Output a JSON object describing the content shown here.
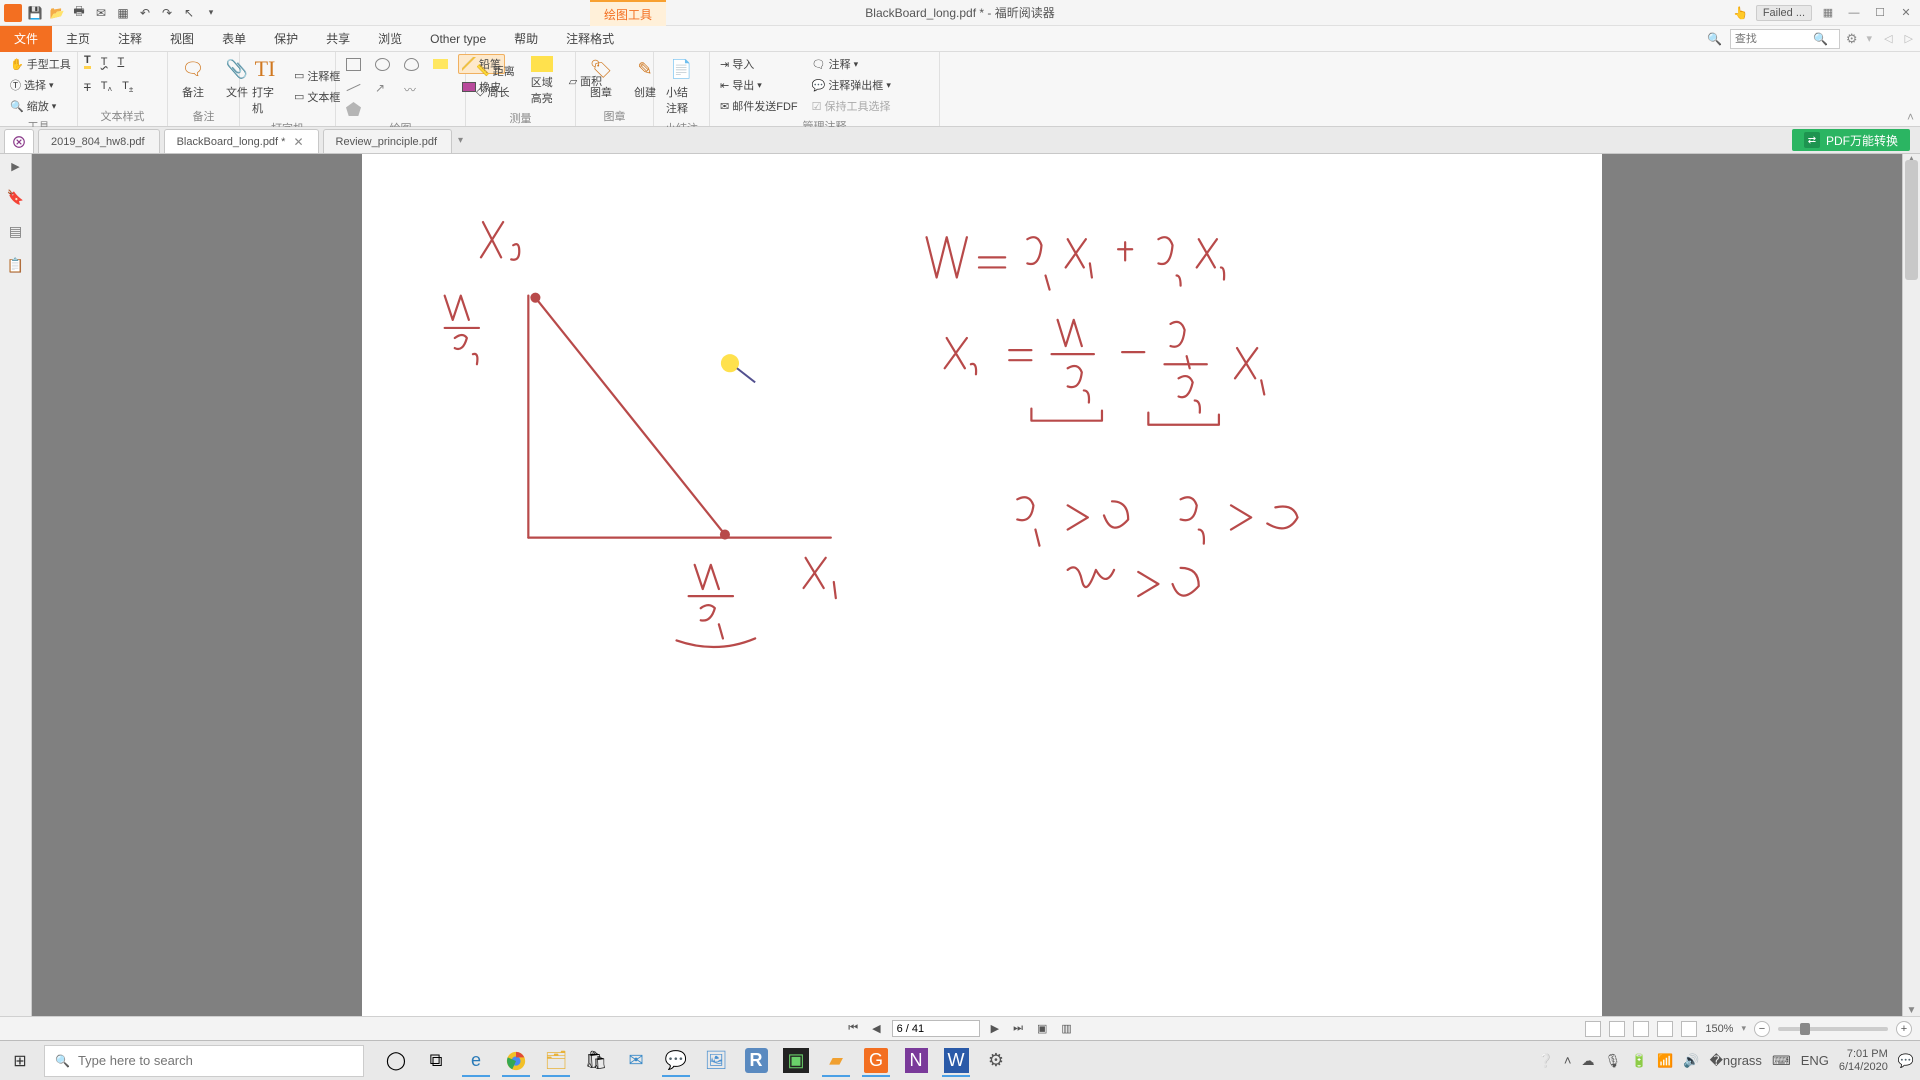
{
  "titlebar": {
    "doc_title": "BlackBoard_long.pdf * - 福昕阅读器",
    "drawing_tools": "绘图工具",
    "failed": "Failed ...",
    "qat": [
      "save-icon",
      "open-icon",
      "print-icon",
      "mail-icon",
      "new-icon",
      "undo-icon",
      "redo-icon",
      "pointer-icon"
    ]
  },
  "menu": {
    "items": [
      "文件",
      "主页",
      "注释",
      "视图",
      "表单",
      "保护",
      "共享",
      "浏览",
      "Other type",
      "帮助",
      "注释格式"
    ],
    "active_index": 0,
    "search_placeholder": "查找"
  },
  "ribbon": {
    "g_tools": {
      "label": "工具",
      "hand": "手型工具",
      "select": "选择",
      "zoom": "缩放"
    },
    "g_text": {
      "label": "文本样式"
    },
    "g_note": {
      "label": "备注",
      "note": "备注",
      "file": "文件"
    },
    "g_type": {
      "label": "打字机",
      "type": "打字机",
      "textbox": "文本框"
    },
    "g_annot": {
      "label": "",
      "box": "注释框",
      "area": "区域高亮"
    },
    "g_draw": {
      "label": "绘图",
      "pencil": "铅笔",
      "eraser": "橡皮"
    },
    "g_meas": {
      "label": "测量",
      "dist": "距离",
      "perim": "周长",
      "areahl": "区域高亮",
      "area": "面积"
    },
    "g_stamp": {
      "label": "图章",
      "stamp": "图章",
      "create": "创建"
    },
    "g_summary": {
      "label": "小结注释",
      "btn": "小结注释"
    },
    "g_manage": {
      "label": "管理注释",
      "import": "导入",
      "export": "导出",
      "mailpdf": "邮件发送FDF",
      "annot": "注释",
      "popup": "注释弹出框",
      "keep": "保持工具选择"
    }
  },
  "tabs": {
    "items": [
      "2019_804_hw8.pdf",
      "BlackBoard_long.pdf *",
      "Review_principle.pdf"
    ],
    "active_index": 1,
    "convert": "PDF万能转换"
  },
  "pagenav": {
    "page": "6 / 41",
    "zoom": "150%"
  },
  "taskbar": {
    "search_placeholder": "Type here to search",
    "lang": "ENG",
    "time": "7:01 PM",
    "date": "6/14/2020"
  }
}
